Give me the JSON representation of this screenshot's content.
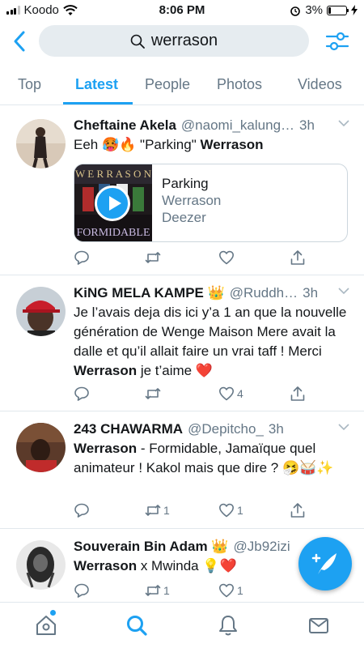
{
  "status_bar": {
    "carrier": "Koodo",
    "time": "8:06 PM",
    "battery": "3%"
  },
  "search": {
    "query": "werrason"
  },
  "tabs": [
    {
      "label": "Top"
    },
    {
      "label": "Latest"
    },
    {
      "label": "People"
    },
    {
      "label": "Photos"
    },
    {
      "label": "Videos"
    }
  ],
  "tweets": [
    {
      "name": "Cheftaine Akela",
      "handle": "@naomi_kalung…",
      "time": "3h",
      "text_pre": "Eeh 🥵🔥 \"Parking\"  ",
      "text_bold": "Werrason",
      "text_post": "",
      "card": {
        "title": "Parking",
        "artist": "Werrason",
        "source": "Deezer"
      },
      "replies": "",
      "retweets": "",
      "likes": ""
    },
    {
      "name": "KiNG MELA KAMPE 👑",
      "handle": "@Ruddh…",
      "time": "3h",
      "text_pre": "Je l’avais deja dis ici y’a 1 an que la nouvelle génération de Wenge Maison Mere avait la dalle et qu’il allait faire un vrai taff ! Merci ",
      "text_bold": "Werrason",
      "text_post": " je t’aime ❤️",
      "replies": "",
      "retweets": "",
      "likes": "4"
    },
    {
      "name": "243 CHAWARMA",
      "handle": "@Depitcho_",
      "time": "3h",
      "text_pre": "",
      "text_bold": "Werrason",
      "text_post": " - Formidable, Jamaïque quel animateur ! Kakol mais que dire ? 🤧🥁✨",
      "replies": "",
      "retweets": "1",
      "likes": "1"
    },
    {
      "name": "Souverain Bin Adam 👑",
      "handle": "@Jb92izi",
      "time": "",
      "text_pre": "",
      "text_bold": "Werrason",
      "text_post": " x Mwinda 💡❤️",
      "replies": "",
      "retweets": "1",
      "likes": "1"
    }
  ],
  "colors": {
    "accent": "#1da1f2",
    "secondary_text": "#657786",
    "divider": "#e1e8ed"
  },
  "icons": [
    "back-icon",
    "search-icon",
    "filter-icon",
    "reply-icon",
    "retweet-icon",
    "like-icon",
    "share-icon",
    "compose-icon",
    "home-icon",
    "explore-icon",
    "notifications-icon",
    "messages-icon"
  ]
}
